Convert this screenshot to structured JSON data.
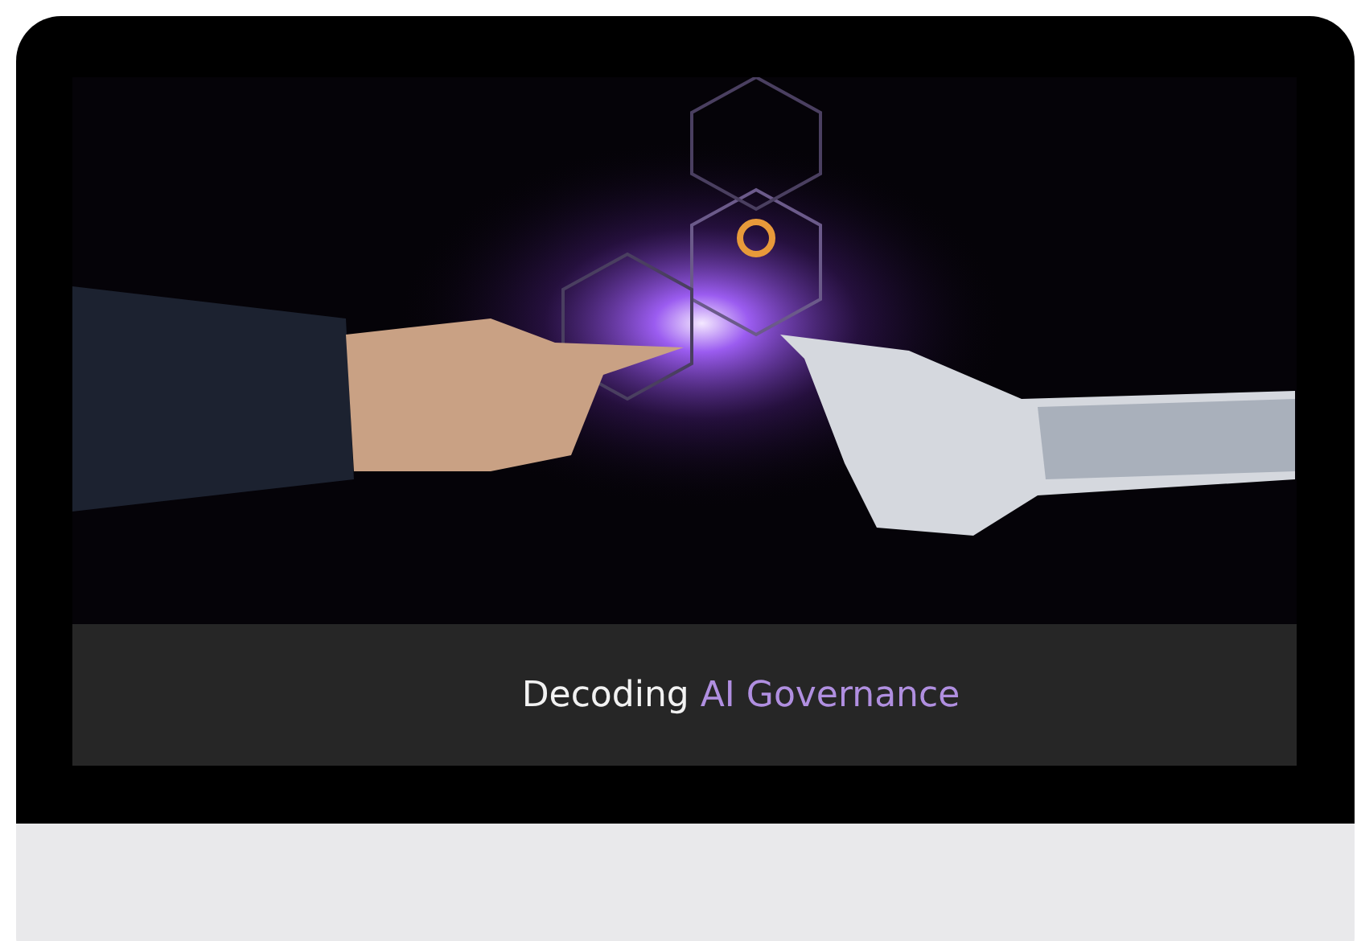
{
  "card": {
    "caption": [
      {
        "text": "Decoding",
        "accent": false
      },
      {
        "text": "AI Governance",
        "accent": true
      }
    ]
  }
}
